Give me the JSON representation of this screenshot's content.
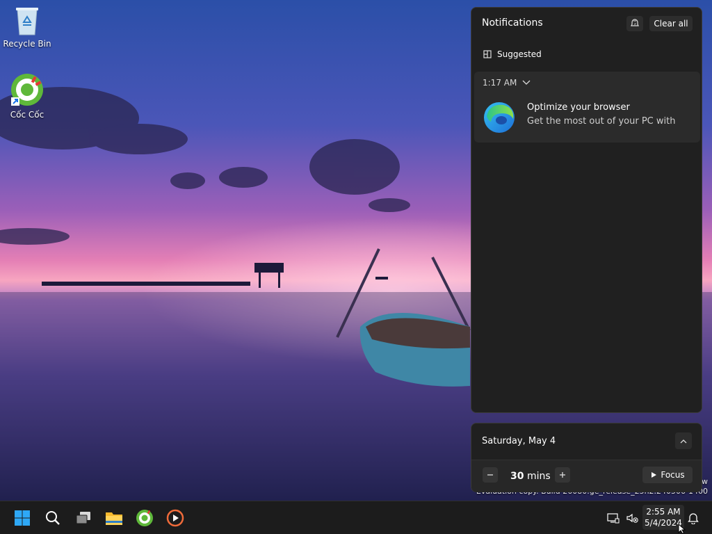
{
  "desktop": {
    "icons": [
      {
        "label": "Recycle Bin",
        "icon": "recycle-bin-icon"
      },
      {
        "label": "Cốc Cốc",
        "icon": "coccoc-icon"
      }
    ]
  },
  "watermark": {
    "line": "Evaluation copy. Build 26080.ge_release_25h2.240506-1400",
    "edition_fragment": "w"
  },
  "notifications": {
    "title": "Notifications",
    "clear_all_label": "Clear all",
    "suggested_label": "Suggested",
    "items": [
      {
        "time": "1:17 AM",
        "headline": "Optimize your browser",
        "body": "Get the most out of your PC with",
        "app_icon": "edge-icon"
      }
    ]
  },
  "calendar": {
    "date_label": "Saturday, May 4",
    "focus": {
      "minutes": "30",
      "unit": "mins",
      "button_label": "Focus"
    }
  },
  "taskbar": {
    "apps": [
      "start-icon",
      "search-icon",
      "task-view-icon",
      "file-explorer-icon",
      "coccoc-icon",
      "media-player-icon"
    ],
    "clock": {
      "time": "2:55 AM",
      "date": "5/4/2024"
    }
  },
  "colors": {
    "accent": "#0a84ff",
    "panel": "#202020",
    "taskbar": "#1c1c1c"
  }
}
